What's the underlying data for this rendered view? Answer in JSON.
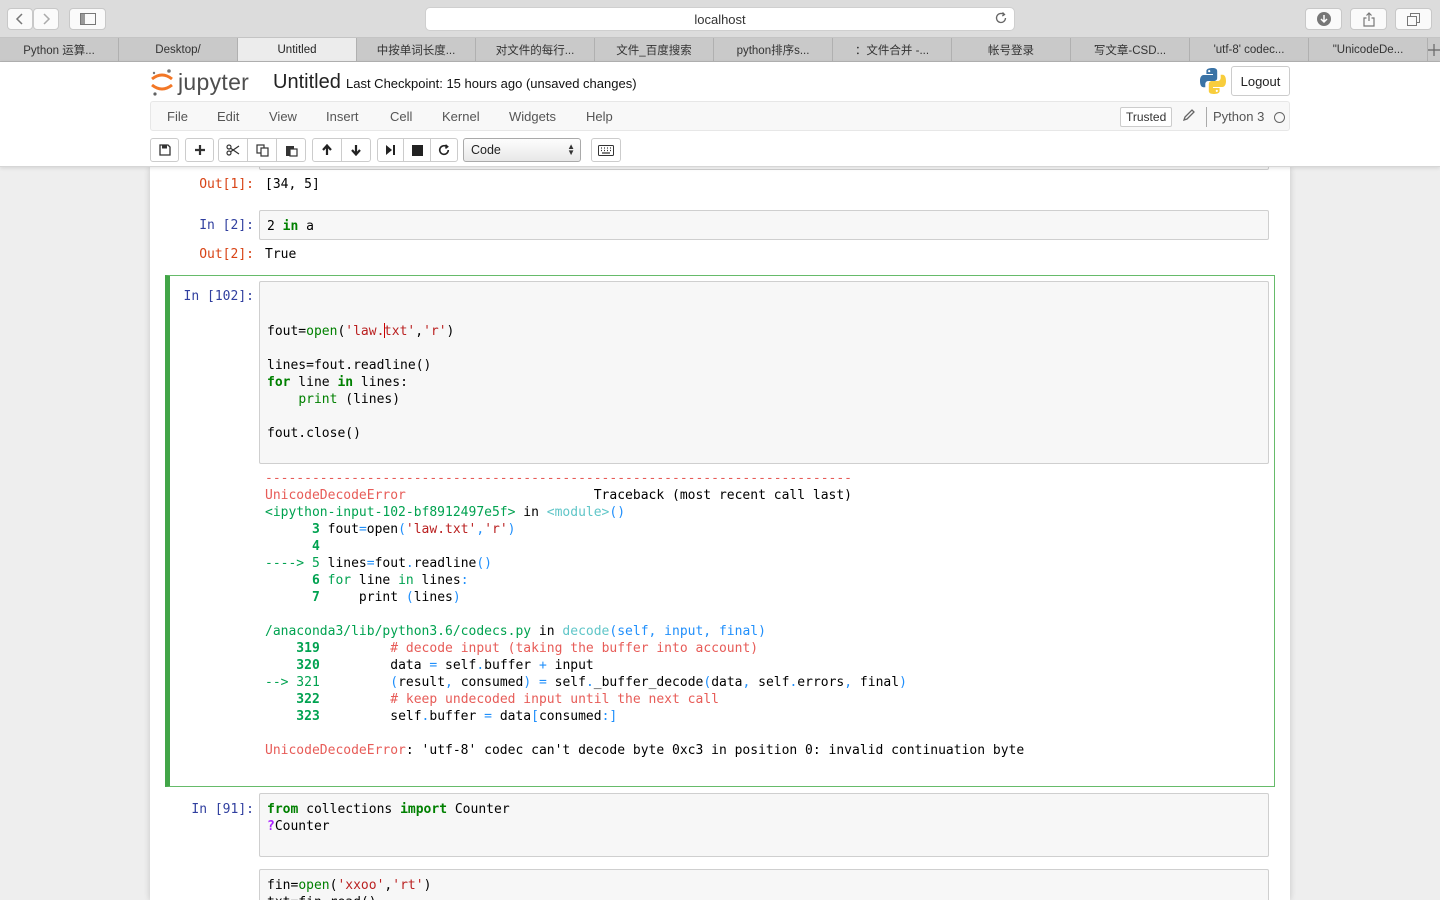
{
  "browser": {
    "address": "localhost",
    "tabs": [
      {
        "label": "Python 运算...",
        "active": false
      },
      {
        "label": "Desktop/",
        "active": false
      },
      {
        "label": "Untitled",
        "active": true
      },
      {
        "label": "中按单词长度...",
        "active": false
      },
      {
        "label": "对文件的每行...",
        "active": false
      },
      {
        "label": "文件_百度搜索",
        "active": false
      },
      {
        "label": "python排序s...",
        "active": false
      },
      {
        "label": "：文件合并 -...",
        "active": false
      },
      {
        "label": "帐号登录",
        "active": false
      },
      {
        "label": "写文章-CSD...",
        "active": false
      },
      {
        "label": "'utf-8' codec...",
        "active": false
      },
      {
        "label": "\"UnicodeDe...",
        "active": false
      }
    ]
  },
  "header": {
    "logo_text": "jupyter",
    "notebook_name": "Untitled",
    "checkpoint": "Last Checkpoint: 15 hours ago (unsaved changes)",
    "logout_label": "Logout"
  },
  "menubar": {
    "items": [
      "File",
      "Edit",
      "View",
      "Insert",
      "Cell",
      "Kernel",
      "Widgets",
      "Help"
    ],
    "trusted_label": "Trusted",
    "kernel_name": "Python 3"
  },
  "toolbar": {
    "cell_type": "Code"
  },
  "cells": {
    "out1_prompt": "Out[1]:",
    "out1_text": "[34, 5]",
    "in2_prompt": "In [2]:",
    "out2_prompt": "Out[2]:",
    "out2_text": "True",
    "in102_prompt": "In [102]:",
    "in91_prompt": "In [91]:"
  },
  "colors": {
    "accent_green": "#42a548",
    "prompt_in": "#303f9f",
    "prompt_out": "#d84315"
  }
}
